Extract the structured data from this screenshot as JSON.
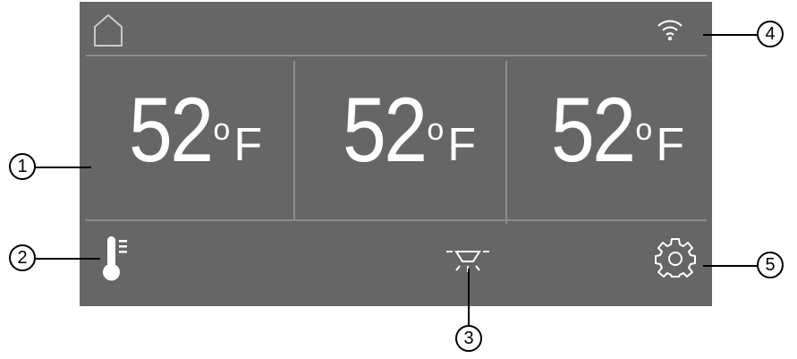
{
  "display": {
    "zones": [
      {
        "temperature": "52",
        "degree_symbol": "o",
        "unit": "F"
      },
      {
        "temperature": "52",
        "degree_symbol": "o",
        "unit": "F"
      },
      {
        "temperature": "52",
        "degree_symbol": "o",
        "unit": "F"
      }
    ],
    "icons": {
      "home": "home-icon",
      "wifi": "wifi-icon",
      "thermometer": "thermometer-icon",
      "light": "light-icon",
      "settings": "gear-icon"
    }
  },
  "callouts": [
    "1",
    "2",
    "3",
    "4",
    "5"
  ],
  "colors": {
    "panel": "#666666",
    "divider": "#8c8c8c",
    "text": "#ffffff"
  }
}
